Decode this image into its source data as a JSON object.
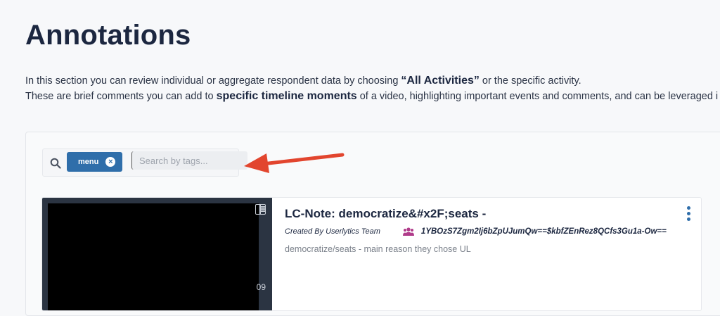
{
  "page": {
    "title": "Annotations",
    "intro_line1_prefix": "In this section you can review individual or aggregate respondent data by choosing ",
    "intro_line1_emph": "“All Activities”",
    "intro_line1_suffix": " or the specific activity.",
    "intro_line2_prefix": "These are brief comments you can add to ",
    "intro_line2_emph": "specific timeline moments",
    "intro_line2_suffix": " of a video, highlighting important events and comments, and can be leveraged i"
  },
  "search": {
    "icon": "search-icon",
    "tag_label": "menu",
    "tag_remove_glyph": "×",
    "placeholder": "Search by tags..."
  },
  "annotation": {
    "title": "LC-Note: democratize&#x2F;seats -",
    "created_by": "Created By Userlytics Team",
    "group_id": "1YBOzS7Zgm2Ij6bZpUJumQw==$kbfZEnRez8QCfs3Gu1a-Ow==",
    "description": "democratize/seats - main reason they chose UL",
    "duration_fragment": "09"
  },
  "colors": {
    "accent": "#2f6eaa",
    "arrow": "#e2452e",
    "group_icon": "#b03b8a"
  }
}
